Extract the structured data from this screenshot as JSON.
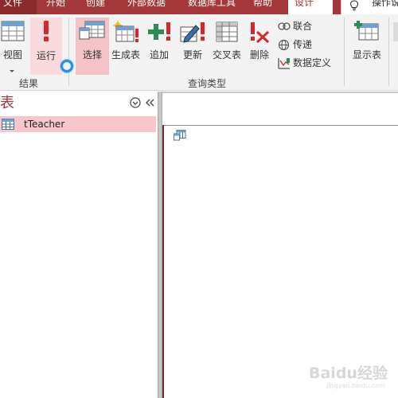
{
  "tabs": {
    "file": "文件",
    "home": "开始",
    "create": "创建",
    "external": "外部数据",
    "dbtools": "数据库工具",
    "help": "帮助",
    "design": "设计",
    "tellme": "操作说"
  },
  "ribbon": {
    "results_group": {
      "label": "结果",
      "view": "视图",
      "run": "运行"
    },
    "query_type_group": {
      "label": "查询类型",
      "select": "选择",
      "make_table": "生成表",
      "append": "追加",
      "update": "更新",
      "crosstab": "交叉表",
      "delete": "删除",
      "union": "联合",
      "pass_through": "传递",
      "data_definition": "数据定义"
    },
    "show_table": "显示表"
  },
  "nav": {
    "title": "表",
    "items": [
      "tTeacher"
    ]
  },
  "watermark": {
    "text": "Baidu经验",
    "sub": "jingyan.baidu.com"
  },
  "colors": {
    "accent": "#a4373a",
    "selected": "#f3c3c7",
    "nav_selected": "#f8c7cb"
  }
}
